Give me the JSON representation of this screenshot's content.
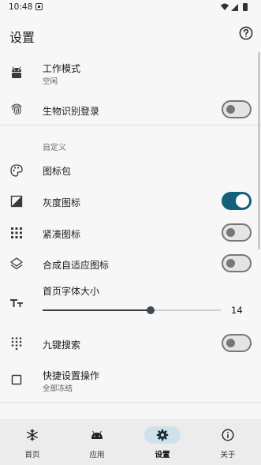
{
  "status_bar": {
    "time": "10:48"
  },
  "header": {
    "title": "设置",
    "help_icon": "help-circle-icon"
  },
  "rows": {
    "work_mode": {
      "title": "工作模式",
      "subtitle": "空闲",
      "icon": "android-icon"
    },
    "biometric": {
      "title": "生物识别登录",
      "icon": "fingerprint-icon",
      "switch_on": false
    },
    "custom_section": "自定义",
    "icon_pack": {
      "title": "图标包",
      "icon": "palette-icon"
    },
    "gray_icon": {
      "title": "灰度图标",
      "icon": "grayscale-image-icon",
      "switch_on": true
    },
    "compact_icon": {
      "title": "紧凑图标",
      "icon": "grid-dots-icon",
      "switch_on": false
    },
    "adaptive_icon": {
      "title": "合成自适应图标",
      "icon": "layers-icon",
      "switch_on": false
    },
    "font_size": {
      "title": "首页字体大小",
      "icon": "font-size-icon",
      "value": "14",
      "fraction": 0.605
    },
    "nine_key": {
      "title": "九键搜索",
      "icon": "keypad-icon",
      "switch_on": false
    },
    "quick_settings": {
      "title": "快捷设置操作",
      "subtitle": "全部冻结",
      "icon": "checkbox-icon"
    }
  },
  "bottom_nav": {
    "items": [
      {
        "label": "首页",
        "icon": "snowflake-icon",
        "active": false
      },
      {
        "label": "应用",
        "icon": "android-icon",
        "active": false
      },
      {
        "label": "设置",
        "icon": "gear-icon",
        "active": true
      },
      {
        "label": "关于",
        "icon": "info-icon",
        "active": false
      }
    ]
  },
  "colors": {
    "accent": "#13607a",
    "nav_active_bg": "#cfe2ec"
  }
}
